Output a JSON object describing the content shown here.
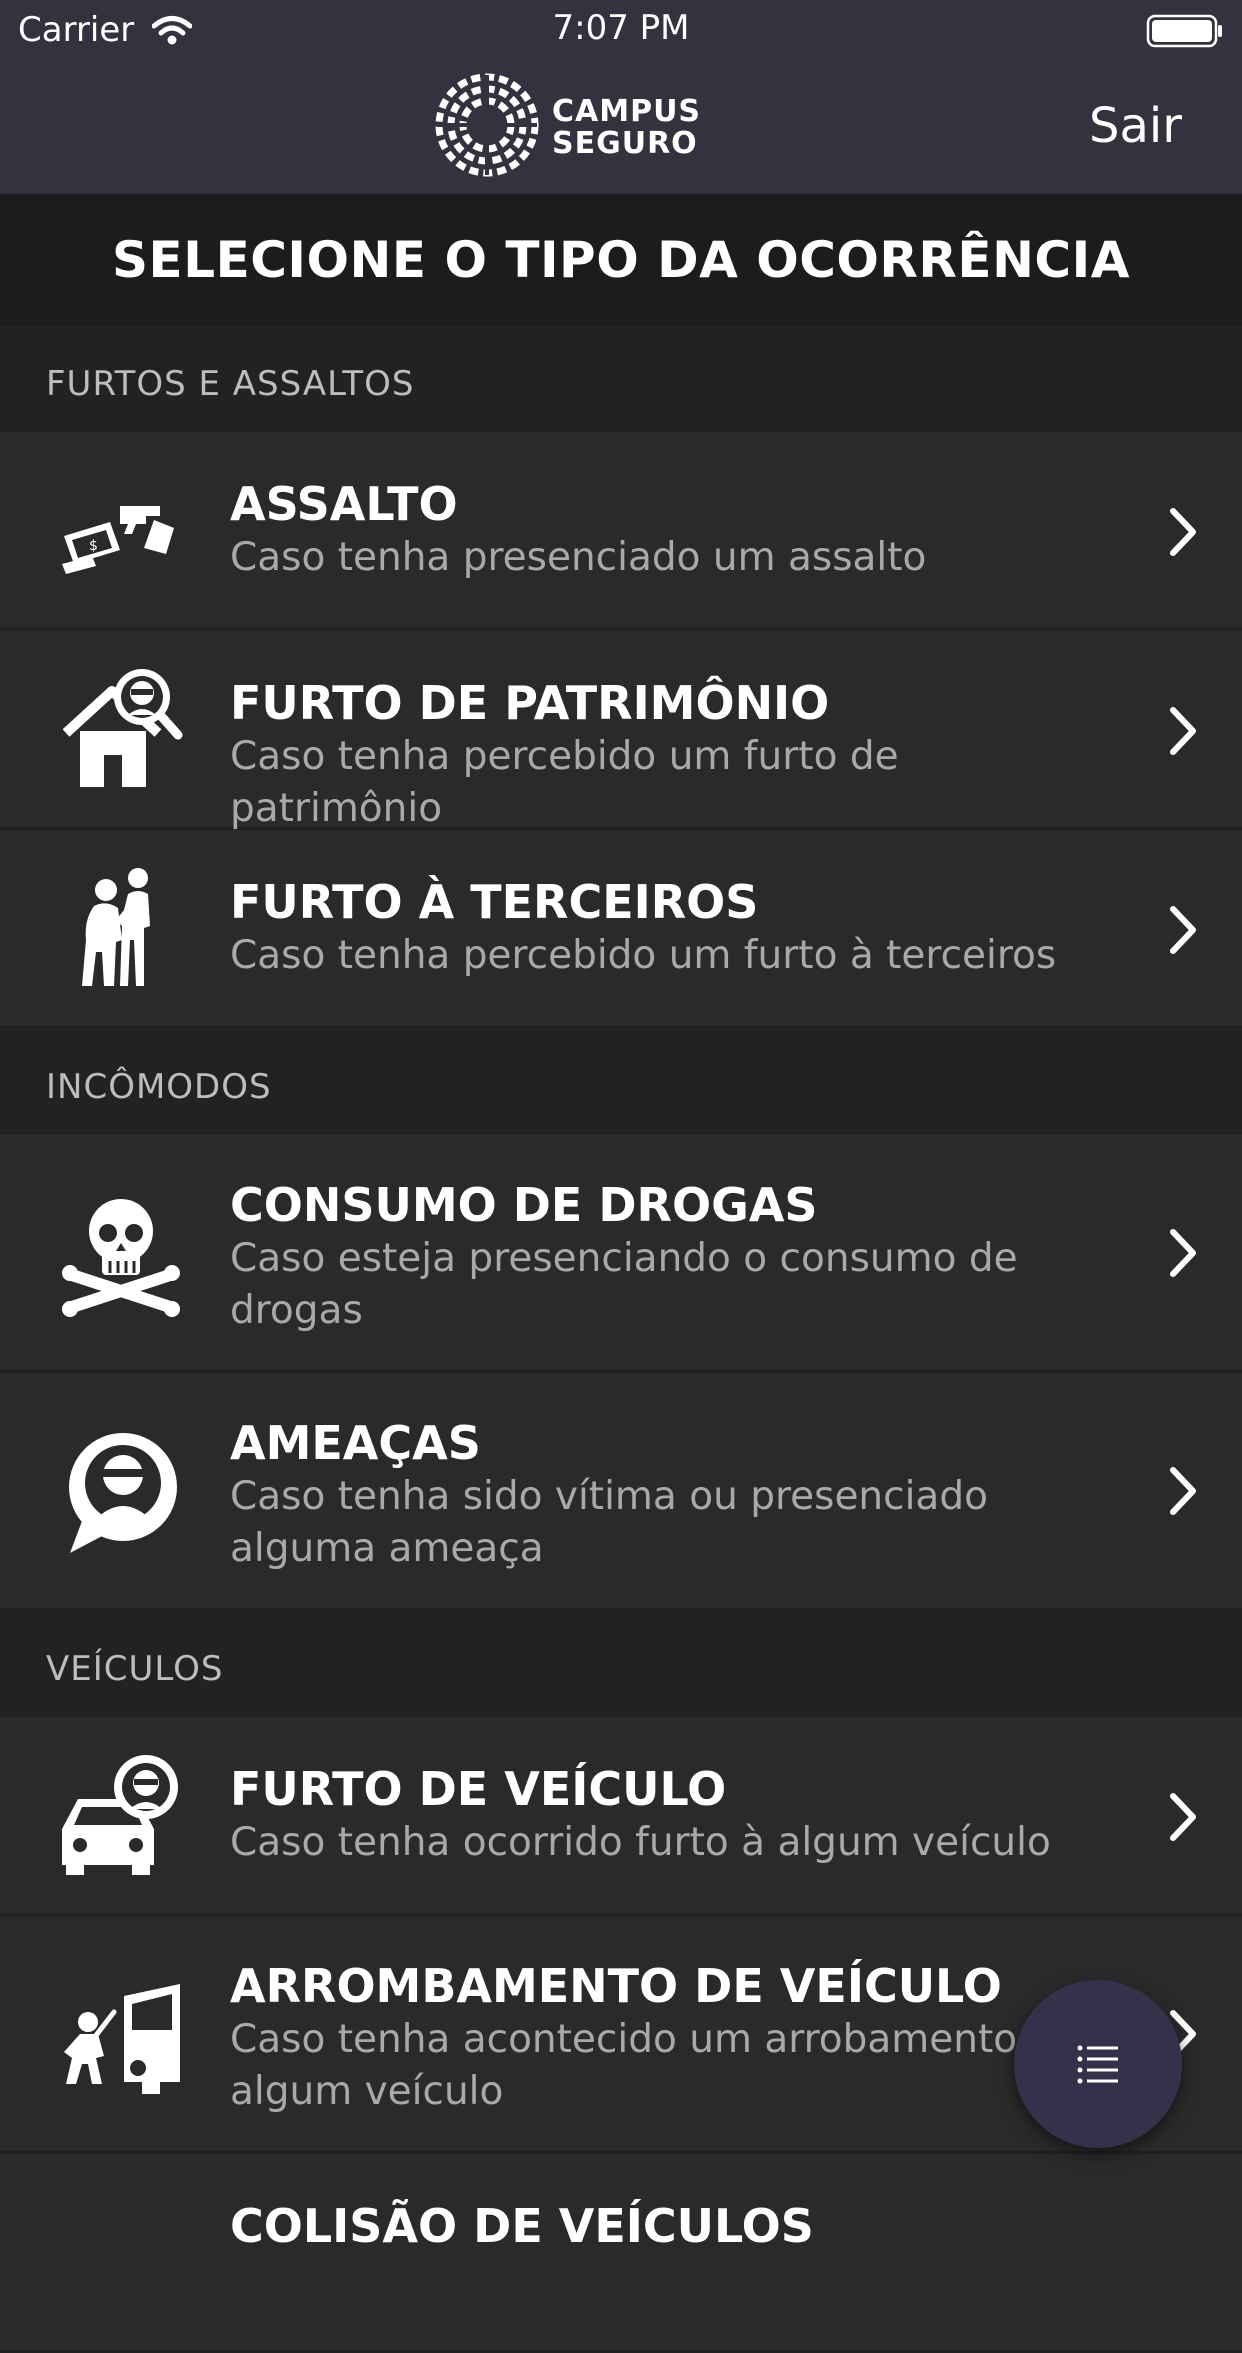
{
  "status_bar": {
    "carrier": "Carrier",
    "time": "7:07 PM"
  },
  "nav": {
    "logo_line1": "CAMPUS",
    "logo_line2": "SEGURO",
    "logout": "Sair"
  },
  "title": "SELECIONE O TIPO DA OCORRÊNCIA",
  "sections": [
    {
      "header": "FURTOS E ASSALTOS",
      "items": [
        {
          "icon": "robbery-gun-icon",
          "title": "ASSALTO",
          "description": "Caso tenha presenciado um assalto"
        },
        {
          "icon": "house-thief-icon",
          "title": "FURTO DE PATRIMÔNIO",
          "description": "Caso tenha percebido um furto de patrimônio"
        },
        {
          "icon": "pickpocket-icon",
          "title": "FURTO À TERCEIROS",
          "description": "Caso tenha percebido um furto à terceiros"
        }
      ]
    },
    {
      "header": "INCÔMODOS",
      "items": [
        {
          "icon": "skull-crossbones-icon",
          "title": "CONSUMO DE DROGAS",
          "description": "Caso esteja presenciando o consumo de drogas"
        },
        {
          "icon": "threat-speech-icon",
          "title": "AMEAÇAS",
          "description": "Caso tenha sido vítima ou presenciado alguma ameaça"
        }
      ]
    },
    {
      "header": "VEÍCULOS",
      "items": [
        {
          "icon": "car-thief-icon",
          "title": "FURTO DE VEÍCULO",
          "description": "Caso tenha ocorrido furto à algum veículo"
        },
        {
          "icon": "car-break-in-icon",
          "title": "ARROMBAMENTO DE VEÍCULO",
          "description": "Caso tenha acontecido um arrobamento à algum veículo"
        },
        {
          "icon": "car-collision-icon",
          "title": "COLISÃO DE VEÍCULOS",
          "description": ""
        }
      ]
    }
  ],
  "fab_icon": "list-icon"
}
